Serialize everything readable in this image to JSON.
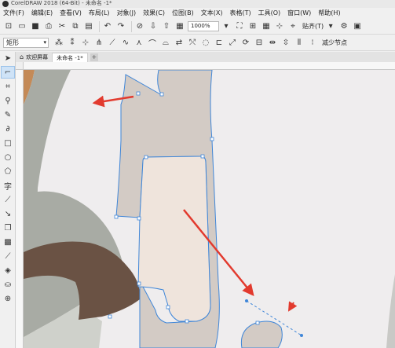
{
  "app": {
    "title": "CorelDRAW 2018 (64-Bit) - 未命名 -1*"
  },
  "menu": {
    "items": [
      "文件(F)",
      "编辑(E)",
      "查看(V)",
      "布局(L)",
      "对象(J)",
      "效果(C)",
      "位图(B)",
      "文本(X)",
      "表格(T)",
      "工具(O)",
      "窗口(W)",
      "帮助(H)"
    ]
  },
  "toolbar": {
    "zoom_value": "1000%",
    "snap_label": "贴齐(T)",
    "shape_select": "矩形",
    "reduce_nodes_label": "减少节点"
  },
  "tabs": {
    "welcome": "欢迎屏幕",
    "document": "未命名 -1*",
    "add_label": "+"
  },
  "colors": {
    "canvas_bg": "#efedee",
    "taupe": "#d3cbc5",
    "cream": "#efe4dc",
    "gray_green": "#a8aba4",
    "dark_brown": "#6a5244",
    "orange": "#c48a57",
    "selection_blue": "#3f86d8",
    "arrow_red": "#e23a2e"
  }
}
